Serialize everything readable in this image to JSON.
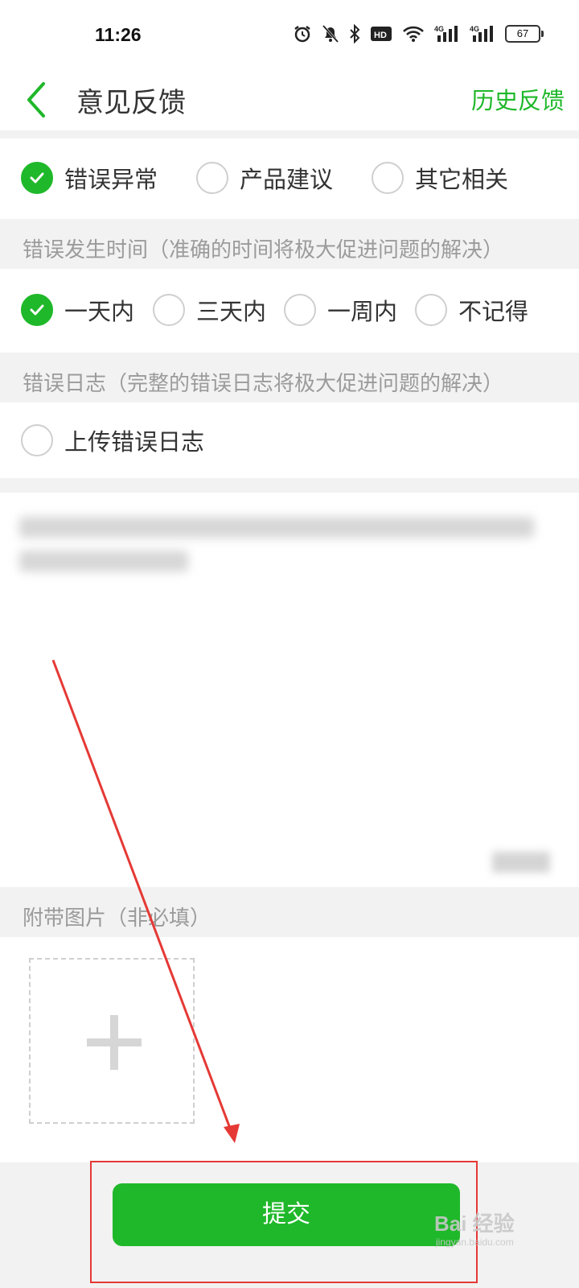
{
  "status_bar": {
    "time": "11:26",
    "battery": "67",
    "icons": [
      "alarm-icon",
      "mute-icon",
      "bluetooth-icon",
      "hd-icon",
      "wifi-icon",
      "signal-4g-icon",
      "signal-4g-icon"
    ]
  },
  "header": {
    "title": "意见反馈",
    "history_label": "历史反馈",
    "accent_color": "#1fb82a"
  },
  "category": {
    "options": [
      {
        "label": "错误异常",
        "selected": true
      },
      {
        "label": "产品建议",
        "selected": false
      },
      {
        "label": "其它相关",
        "selected": false
      }
    ]
  },
  "time_section": {
    "hint": "错误发生时间（准确的时间将极大促进问题的解决）",
    "options": [
      {
        "label": "一天内",
        "selected": true
      },
      {
        "label": "三天内",
        "selected": false
      },
      {
        "label": "一周内",
        "selected": false
      },
      {
        "label": "不记得",
        "selected": false
      }
    ]
  },
  "log_section": {
    "hint": "错误日志（完整的错误日志将极大促进问题的解决）",
    "option_label": "上传错误日志",
    "selected": false
  },
  "attachment": {
    "hint": "附带图片（非必填）"
  },
  "footer": {
    "submit_label": "提交"
  },
  "watermark": {
    "brand": "Bai 经验",
    "url": "jingyan.baidu.com"
  }
}
